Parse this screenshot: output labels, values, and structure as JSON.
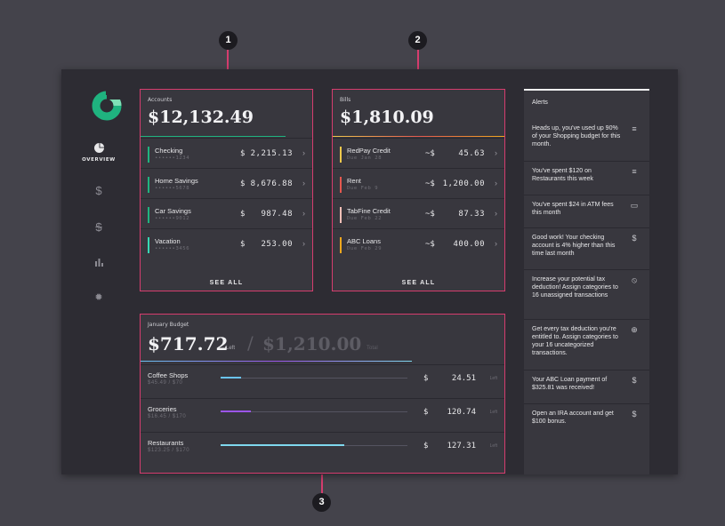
{
  "sidebar": {
    "items": [
      {
        "label": "OVERVIEW",
        "icon": "pie-chart-icon"
      },
      {
        "label": "",
        "icon": "dollar-icon"
      },
      {
        "label": "",
        "icon": "transfer-icon"
      },
      {
        "label": "",
        "icon": "bar-chart-icon"
      },
      {
        "label": "",
        "icon": "gear-icon"
      }
    ]
  },
  "accounts": {
    "label": "Accounts",
    "total": "$12,132.49",
    "items": [
      {
        "name": "Checking",
        "number": "••••••1234",
        "currency": "$",
        "amount": "2,215.13",
        "color": "#1fb37f"
      },
      {
        "name": "Home Savings",
        "number": "••••••5678",
        "currency": "$",
        "amount": "8,676.88",
        "color": "#1fb37f"
      },
      {
        "name": "Car Savings",
        "number": "••••••9012",
        "currency": "$",
        "amount": "987.48",
        "color": "#1fb37f"
      },
      {
        "name": "Vacation",
        "number": "••••••3456",
        "currency": "$",
        "amount": "253.00",
        "color": "#37d8b4"
      }
    ],
    "see_all": "SEE ALL"
  },
  "bills": {
    "label": "Bills",
    "total": "$1,810.09",
    "items": [
      {
        "name": "RedPay Credit",
        "due": "Due Jan 28",
        "currency": "~$",
        "amount": "45.63",
        "color": "#f2c94c"
      },
      {
        "name": "Rent",
        "due": "Due Feb 9",
        "currency": "~$",
        "amount": "1,200.00",
        "color": "#e4584f"
      },
      {
        "name": "TabFine Credit",
        "due": "Due Feb 22",
        "currency": "~$",
        "amount": "87.33",
        "color": "#f5c0b8"
      },
      {
        "name": "ABC Loans",
        "due": "Due Feb 29",
        "currency": "~$",
        "amount": "400.00",
        "color": "#f2a81d"
      }
    ],
    "see_all": "SEE ALL"
  },
  "budget": {
    "label": "January Budget",
    "left_amount": "$717.72",
    "left_label": "Left",
    "separator": "/",
    "total_amount": "$1,210.00",
    "total_label": "Total",
    "items": [
      {
        "name": "Coffee Shops",
        "spent": "$45.49 / $70",
        "currency": "$",
        "amount": "24.51",
        "left": "Left",
        "progress": 0.11,
        "color": "#6ac3f2"
      },
      {
        "name": "Groceries",
        "spent": "$16.45 / $170",
        "currency": "$",
        "amount": "120.74",
        "left": "Left",
        "progress": 0.16,
        "color": "#9b55e8"
      },
      {
        "name": "Restaurants",
        "spent": "$123.25 / $170",
        "currency": "$",
        "amount": "127.31",
        "left": "Left",
        "progress": 0.66,
        "color": "#7fd8ee"
      }
    ]
  },
  "alerts": {
    "title": "Alerts",
    "items": [
      {
        "text": "Heads up, you've used up 90% of your Shopping budget for this month.",
        "icon": "sort-icon"
      },
      {
        "text": "You've spent $120 on Restaurants this week",
        "icon": "sort-icon"
      },
      {
        "text": "You've spent $24 in ATM fees this month",
        "icon": "card-icon"
      },
      {
        "text": "Good work! Your checking account is 4% higher than this time last month",
        "icon": "dollar-icon"
      },
      {
        "text": "Increase your potential tax deduction! Assign categories to 16 unassigned transactions",
        "icon": "block-icon"
      },
      {
        "text": "Get every tax deduction you're entitled to. Assign categories to your 16 uncategorized transactions.",
        "icon": "pie-chart-icon"
      },
      {
        "text": "Your ABC Loan payment of $325.81 was received!",
        "icon": "dollar-icon"
      },
      {
        "text": "Open an IRA account and get $100 bonus.",
        "icon": "dollar-icon"
      }
    ]
  },
  "markers": [
    "1",
    "2",
    "3"
  ]
}
